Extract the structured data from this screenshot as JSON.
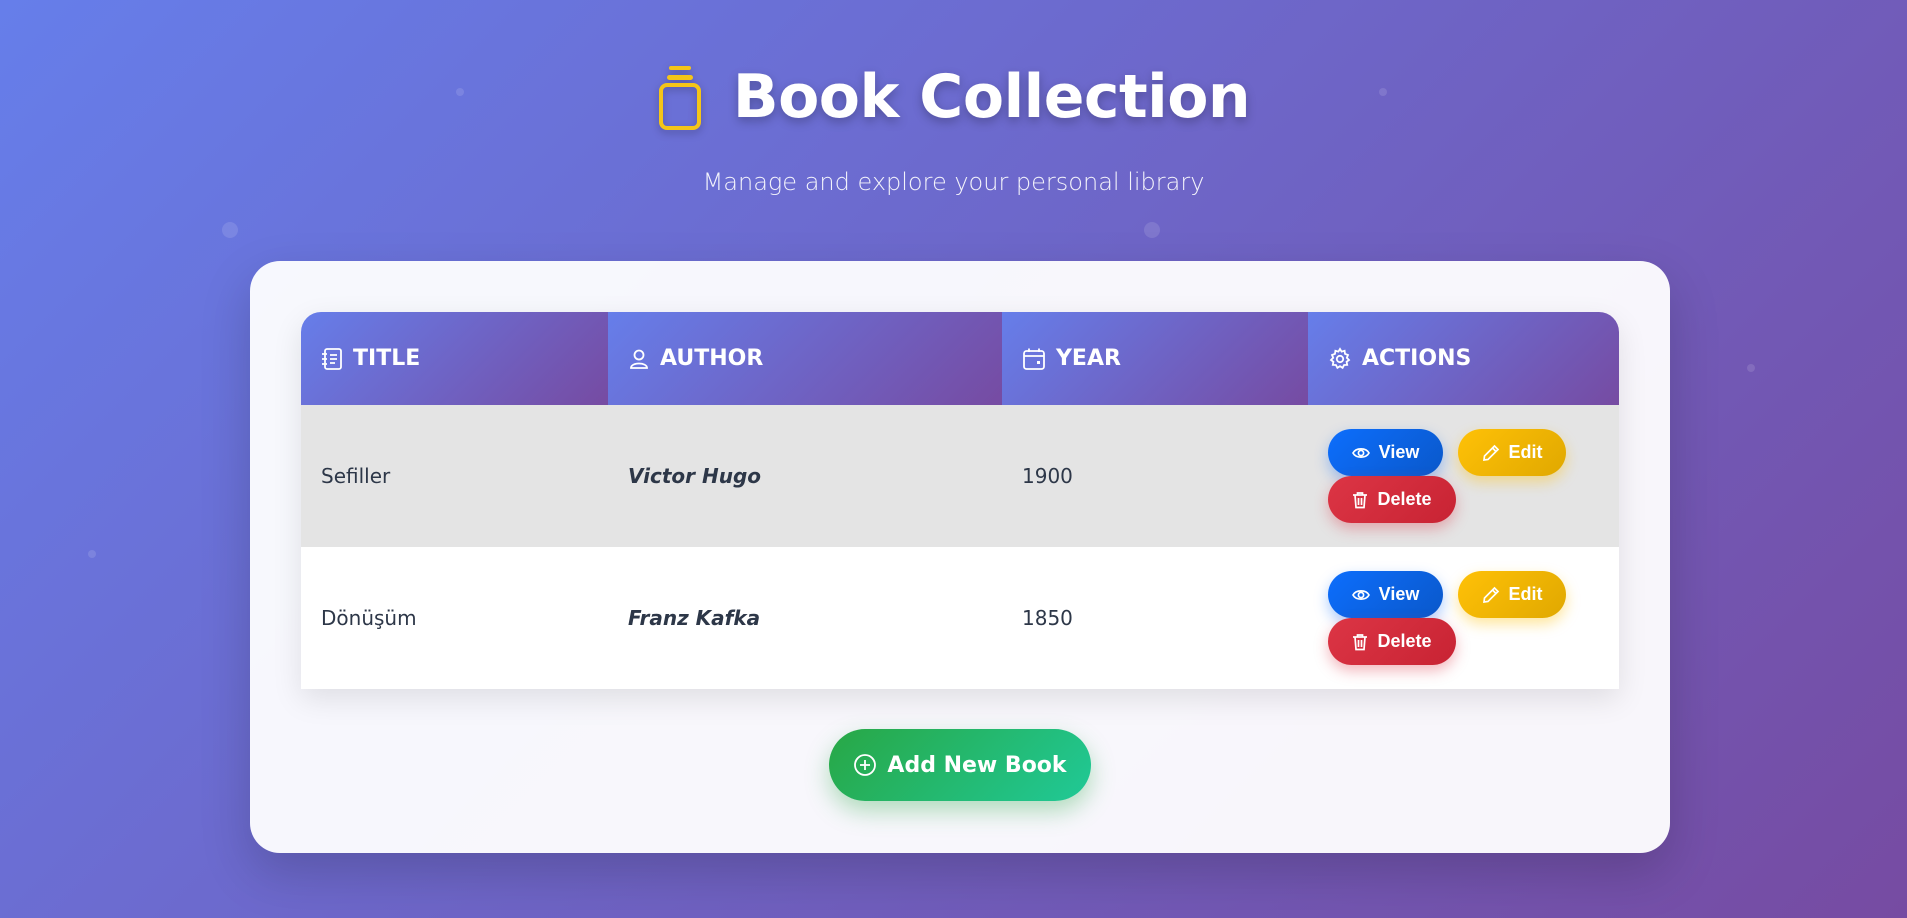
{
  "header": {
    "title": "Book Collection",
    "subtitle": "Manage and explore your personal library",
    "icon": "book-icon"
  },
  "table": {
    "columns": [
      {
        "label": "TITLE",
        "icon": "journal-icon"
      },
      {
        "label": "AUTHOR",
        "icon": "person-icon"
      },
      {
        "label": "YEAR",
        "icon": "calendar-icon"
      },
      {
        "label": "ACTIONS",
        "icon": "gear-icon"
      }
    ],
    "rows": [
      {
        "title": "Sefiller",
        "author": "Victor Hugo",
        "year": "1900"
      },
      {
        "title": "Dönüşüm",
        "author": "Franz Kafka",
        "year": "1850"
      }
    ],
    "actions": {
      "view": "View",
      "edit": "Edit",
      "delete": "Delete"
    }
  },
  "add_button": {
    "label": "Add New Book",
    "icon": "plus-circle-icon"
  },
  "colors": {
    "gradient_start": "#667eea",
    "gradient_end": "#764ba2",
    "view": "#0d6efd",
    "edit": "#ffc107",
    "delete": "#dc3545",
    "add": "#28a745",
    "title_icon": "#f5c518"
  }
}
